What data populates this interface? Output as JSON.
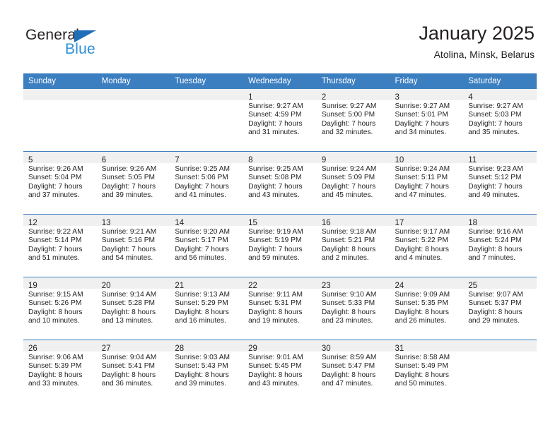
{
  "brand": {
    "name_part1": "General",
    "name_part2": "Blue",
    "triangle_color": "#1f6fb8",
    "blue_text_color": "#2e8fd6"
  },
  "header": {
    "title": "January 2025",
    "subtitle": "Atolina, Minsk, Belarus"
  },
  "theme": {
    "header_bg": "#3c7fc1",
    "daynum_bg": "#f0f0f0",
    "text": "#231f20"
  },
  "weekday_headers": [
    "Sunday",
    "Monday",
    "Tuesday",
    "Wednesday",
    "Thursday",
    "Friday",
    "Saturday"
  ],
  "weeks": [
    [
      {
        "day": "",
        "lines": []
      },
      {
        "day": "",
        "lines": []
      },
      {
        "day": "",
        "lines": []
      },
      {
        "day": "1",
        "lines": [
          "Sunrise: 9:27 AM",
          "Sunset: 4:59 PM",
          "Daylight: 7 hours",
          "and 31 minutes."
        ]
      },
      {
        "day": "2",
        "lines": [
          "Sunrise: 9:27 AM",
          "Sunset: 5:00 PM",
          "Daylight: 7 hours",
          "and 32 minutes."
        ]
      },
      {
        "day": "3",
        "lines": [
          "Sunrise: 9:27 AM",
          "Sunset: 5:01 PM",
          "Daylight: 7 hours",
          "and 34 minutes."
        ]
      },
      {
        "day": "4",
        "lines": [
          "Sunrise: 9:27 AM",
          "Sunset: 5:03 PM",
          "Daylight: 7 hours",
          "and 35 minutes."
        ]
      }
    ],
    [
      {
        "day": "5",
        "lines": [
          "Sunrise: 9:26 AM",
          "Sunset: 5:04 PM",
          "Daylight: 7 hours",
          "and 37 minutes."
        ]
      },
      {
        "day": "6",
        "lines": [
          "Sunrise: 9:26 AM",
          "Sunset: 5:05 PM",
          "Daylight: 7 hours",
          "and 39 minutes."
        ]
      },
      {
        "day": "7",
        "lines": [
          "Sunrise: 9:25 AM",
          "Sunset: 5:06 PM",
          "Daylight: 7 hours",
          "and 41 minutes."
        ]
      },
      {
        "day": "8",
        "lines": [
          "Sunrise: 9:25 AM",
          "Sunset: 5:08 PM",
          "Daylight: 7 hours",
          "and 43 minutes."
        ]
      },
      {
        "day": "9",
        "lines": [
          "Sunrise: 9:24 AM",
          "Sunset: 5:09 PM",
          "Daylight: 7 hours",
          "and 45 minutes."
        ]
      },
      {
        "day": "10",
        "lines": [
          "Sunrise: 9:24 AM",
          "Sunset: 5:11 PM",
          "Daylight: 7 hours",
          "and 47 minutes."
        ]
      },
      {
        "day": "11",
        "lines": [
          "Sunrise: 9:23 AM",
          "Sunset: 5:12 PM",
          "Daylight: 7 hours",
          "and 49 minutes."
        ]
      }
    ],
    [
      {
        "day": "12",
        "lines": [
          "Sunrise: 9:22 AM",
          "Sunset: 5:14 PM",
          "Daylight: 7 hours",
          "and 51 minutes."
        ]
      },
      {
        "day": "13",
        "lines": [
          "Sunrise: 9:21 AM",
          "Sunset: 5:16 PM",
          "Daylight: 7 hours",
          "and 54 minutes."
        ]
      },
      {
        "day": "14",
        "lines": [
          "Sunrise: 9:20 AM",
          "Sunset: 5:17 PM",
          "Daylight: 7 hours",
          "and 56 minutes."
        ]
      },
      {
        "day": "15",
        "lines": [
          "Sunrise: 9:19 AM",
          "Sunset: 5:19 PM",
          "Daylight: 7 hours",
          "and 59 minutes."
        ]
      },
      {
        "day": "16",
        "lines": [
          "Sunrise: 9:18 AM",
          "Sunset: 5:21 PM",
          "Daylight: 8 hours",
          "and 2 minutes."
        ]
      },
      {
        "day": "17",
        "lines": [
          "Sunrise: 9:17 AM",
          "Sunset: 5:22 PM",
          "Daylight: 8 hours",
          "and 4 minutes."
        ]
      },
      {
        "day": "18",
        "lines": [
          "Sunrise: 9:16 AM",
          "Sunset: 5:24 PM",
          "Daylight: 8 hours",
          "and 7 minutes."
        ]
      }
    ],
    [
      {
        "day": "19",
        "lines": [
          "Sunrise: 9:15 AM",
          "Sunset: 5:26 PM",
          "Daylight: 8 hours",
          "and 10 minutes."
        ]
      },
      {
        "day": "20",
        "lines": [
          "Sunrise: 9:14 AM",
          "Sunset: 5:28 PM",
          "Daylight: 8 hours",
          "and 13 minutes."
        ]
      },
      {
        "day": "21",
        "lines": [
          "Sunrise: 9:13 AM",
          "Sunset: 5:29 PM",
          "Daylight: 8 hours",
          "and 16 minutes."
        ]
      },
      {
        "day": "22",
        "lines": [
          "Sunrise: 9:11 AM",
          "Sunset: 5:31 PM",
          "Daylight: 8 hours",
          "and 19 minutes."
        ]
      },
      {
        "day": "23",
        "lines": [
          "Sunrise: 9:10 AM",
          "Sunset: 5:33 PM",
          "Daylight: 8 hours",
          "and 23 minutes."
        ]
      },
      {
        "day": "24",
        "lines": [
          "Sunrise: 9:09 AM",
          "Sunset: 5:35 PM",
          "Daylight: 8 hours",
          "and 26 minutes."
        ]
      },
      {
        "day": "25",
        "lines": [
          "Sunrise: 9:07 AM",
          "Sunset: 5:37 PM",
          "Daylight: 8 hours",
          "and 29 minutes."
        ]
      }
    ],
    [
      {
        "day": "26",
        "lines": [
          "Sunrise: 9:06 AM",
          "Sunset: 5:39 PM",
          "Daylight: 8 hours",
          "and 33 minutes."
        ]
      },
      {
        "day": "27",
        "lines": [
          "Sunrise: 9:04 AM",
          "Sunset: 5:41 PM",
          "Daylight: 8 hours",
          "and 36 minutes."
        ]
      },
      {
        "day": "28",
        "lines": [
          "Sunrise: 9:03 AM",
          "Sunset: 5:43 PM",
          "Daylight: 8 hours",
          "and 39 minutes."
        ]
      },
      {
        "day": "29",
        "lines": [
          "Sunrise: 9:01 AM",
          "Sunset: 5:45 PM",
          "Daylight: 8 hours",
          "and 43 minutes."
        ]
      },
      {
        "day": "30",
        "lines": [
          "Sunrise: 8:59 AM",
          "Sunset: 5:47 PM",
          "Daylight: 8 hours",
          "and 47 minutes."
        ]
      },
      {
        "day": "31",
        "lines": [
          "Sunrise: 8:58 AM",
          "Sunset: 5:49 PM",
          "Daylight: 8 hours",
          "and 50 minutes."
        ]
      },
      {
        "day": "",
        "lines": []
      }
    ]
  ]
}
